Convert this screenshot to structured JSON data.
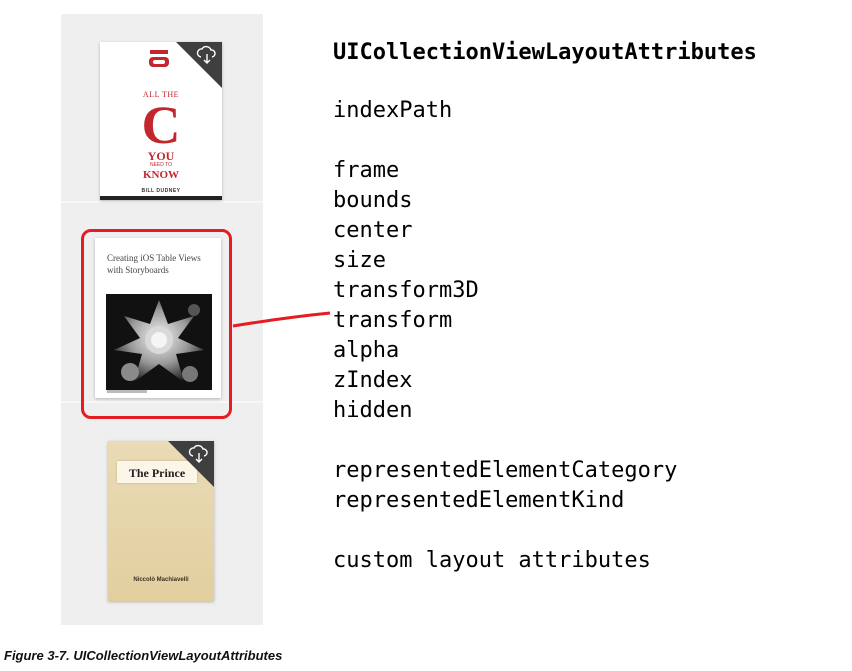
{
  "books": [
    {
      "series": "ALL THE",
      "big_letter": "C",
      "line_you": "YOU",
      "line_need": "NEED TO",
      "line_know": "KNOW",
      "author": "BILL DUDNEY",
      "badge_icon": "cloud-download-icon"
    },
    {
      "title": "Creating iOS Table Views with Storyboards",
      "cover_art": "fractal-romanesco-image"
    },
    {
      "title": "The Prince",
      "author": "Niccolò Machiavelli",
      "badge_icon": "cloud-download-icon"
    }
  ],
  "highlight_color": "#e51c23",
  "attributes": {
    "heading": "UICollectionViewLayoutAttributes",
    "groups": [
      [
        "indexPath"
      ],
      [
        "frame",
        "bounds",
        "center",
        "size",
        "transform3D",
        "transform",
        "alpha",
        "zIndex",
        "hidden"
      ],
      [
        "representedElementCategory",
        "representedElementKind"
      ],
      [
        "custom layout attributes"
      ]
    ]
  },
  "caption": "Figure 3-7.  UICollectionViewLayoutAttributes"
}
